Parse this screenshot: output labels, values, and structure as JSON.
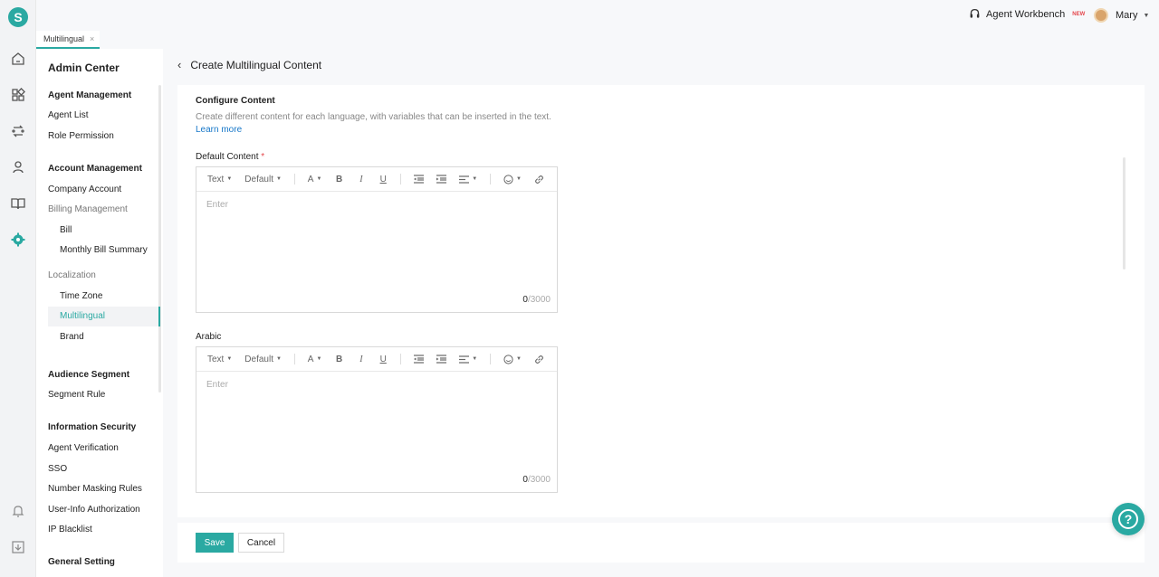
{
  "app": {
    "logo_letter": "S",
    "accent": "#2aa9a2"
  },
  "header": {
    "workbench_label": "Agent Workbench",
    "workbench_badge": "NEW",
    "user_name": "Mary"
  },
  "tabs": [
    {
      "label": "Multilingual",
      "close": "×"
    }
  ],
  "sidebar": {
    "title": "Admin Center",
    "groups": [
      {
        "label": "Agent Management",
        "items": [
          "Agent List",
          "Role Permission"
        ]
      },
      {
        "label": "Account Management",
        "items": [
          "Company Account"
        ]
      },
      {
        "label": "Billing Management",
        "items": [
          "Bill",
          "Monthly Bill Summary"
        ]
      },
      {
        "label": "Localization",
        "items": [
          "Time Zone",
          "Multilingual",
          "Brand"
        ]
      },
      {
        "label": "Audience Segment",
        "items": [
          "Segment Rule"
        ]
      },
      {
        "label": "Information Security",
        "items": [
          "Agent Verification",
          "SSO",
          "Number Masking Rules",
          "User-Info Authorization",
          "IP Blacklist"
        ]
      },
      {
        "label": "General Setting",
        "items": []
      }
    ]
  },
  "page": {
    "back": "‹",
    "title": "Create Multilingual Content",
    "section_title": "Configure Content",
    "section_desc": "Create different content for each language, with variables that can be inserted in the text.",
    "learn_more": "Learn more"
  },
  "editors": [
    {
      "label": "Default Content",
      "required": "*",
      "placeholder": "Enter",
      "count": "0",
      "max": "/3000"
    },
    {
      "label": "Arabic",
      "required": "",
      "placeholder": "Enter",
      "count": "0",
      "max": "/3000"
    }
  ],
  "toolbar": {
    "text": "Text",
    "font": "Default"
  },
  "footer": {
    "save": "Save",
    "cancel": "Cancel"
  },
  "help": {
    "icon": "?"
  }
}
